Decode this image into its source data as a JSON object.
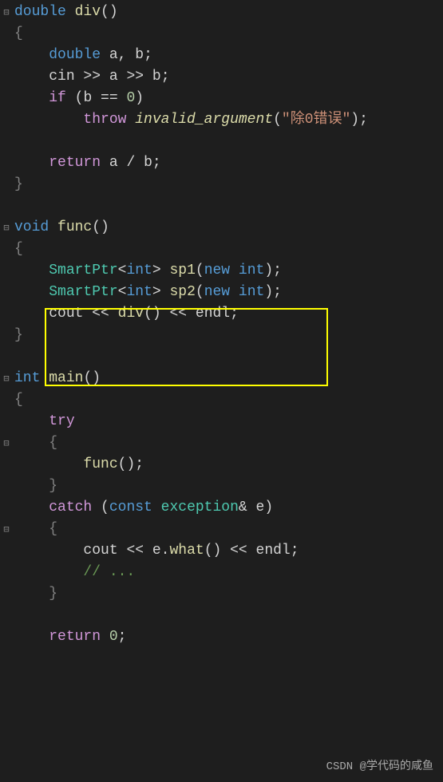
{
  "code": {
    "l1_double": "double",
    "l1_div": "div",
    "l1_parens": "()",
    "l2_brace": "{",
    "l3_double": "double",
    "l3_a": "a",
    "l3_comma": ", ",
    "l3_b": "b",
    "l3_semi": ";",
    "l4_cin": "cin",
    "l4_op1": " >> ",
    "l4_a": "a",
    "l4_op2": " >> ",
    "l4_b": "b",
    "l4_semi": ";",
    "l5_if": "if",
    "l5_open": " (",
    "l5_b": "b",
    "l5_eq": " == ",
    "l5_zero": "0",
    "l5_close": ")",
    "l6_throw": "throw",
    "l6_sp": " ",
    "l6_invalid": "invalid_argument",
    "l6_open": "(",
    "l6_str": "\"除0错误\"",
    "l6_close": ")",
    "l6_semi": ";",
    "l8_return": "return",
    "l8_sp": " ",
    "l8_a": "a",
    "l8_div": " / ",
    "l8_b": "b",
    "l8_semi": ";",
    "l9_brace": "}",
    "l11_void": "void",
    "l11_func": "func",
    "l11_parens": "()",
    "l12_brace": "{",
    "l13_SmartPtr": "SmartPtr",
    "l13_lt": "<",
    "l13_int": "int",
    "l13_gt": "> ",
    "l13_sp1": "sp1",
    "l13_open": "(",
    "l13_new": "new",
    "l13_sp": " ",
    "l13_int2": "int",
    "l13_close": ")",
    "l13_semi": ";",
    "l14_SmartPtr": "SmartPtr",
    "l14_lt": "<",
    "l14_int": "int",
    "l14_gt": "> ",
    "l14_sp2": "sp2",
    "l14_open": "(",
    "l14_new": "new",
    "l14_sp": " ",
    "l14_int2": "int",
    "l14_close": ")",
    "l14_semi": ";",
    "l15_cout": "cout",
    "l15_op1": " << ",
    "l15_div": "div",
    "l15_parens": "()",
    "l15_op2": " << ",
    "l15_endl": "endl",
    "l15_semi": ";",
    "l16_brace": "}",
    "l18_int": "int",
    "l18_main": "main",
    "l18_parens": "()",
    "l19_brace": "{",
    "l20_try": "try",
    "l21_brace": "{",
    "l22_func": "func",
    "l22_parens": "()",
    "l22_semi": ";",
    "l23_brace": "}",
    "l24_catch": "catch",
    "l24_open": " (",
    "l24_const": "const",
    "l24_sp": " ",
    "l24_exception": "exception",
    "l24_amp": "& ",
    "l24_e": "e",
    "l24_close": ")",
    "l25_brace": "{",
    "l26_cout": "cout",
    "l26_op1": " << ",
    "l26_e": "e",
    "l26_dot": ".",
    "l26_what": "what",
    "l26_parens": "()",
    "l26_op2": " << ",
    "l26_endl": "endl",
    "l26_semi": ";",
    "l27_comment": "// ...",
    "l28_brace": "}",
    "l30_return": "return",
    "l30_sp": " ",
    "l30_zero": "0",
    "l30_semi": ";",
    "watermark": "CSDN @学代码的咸鱼"
  }
}
